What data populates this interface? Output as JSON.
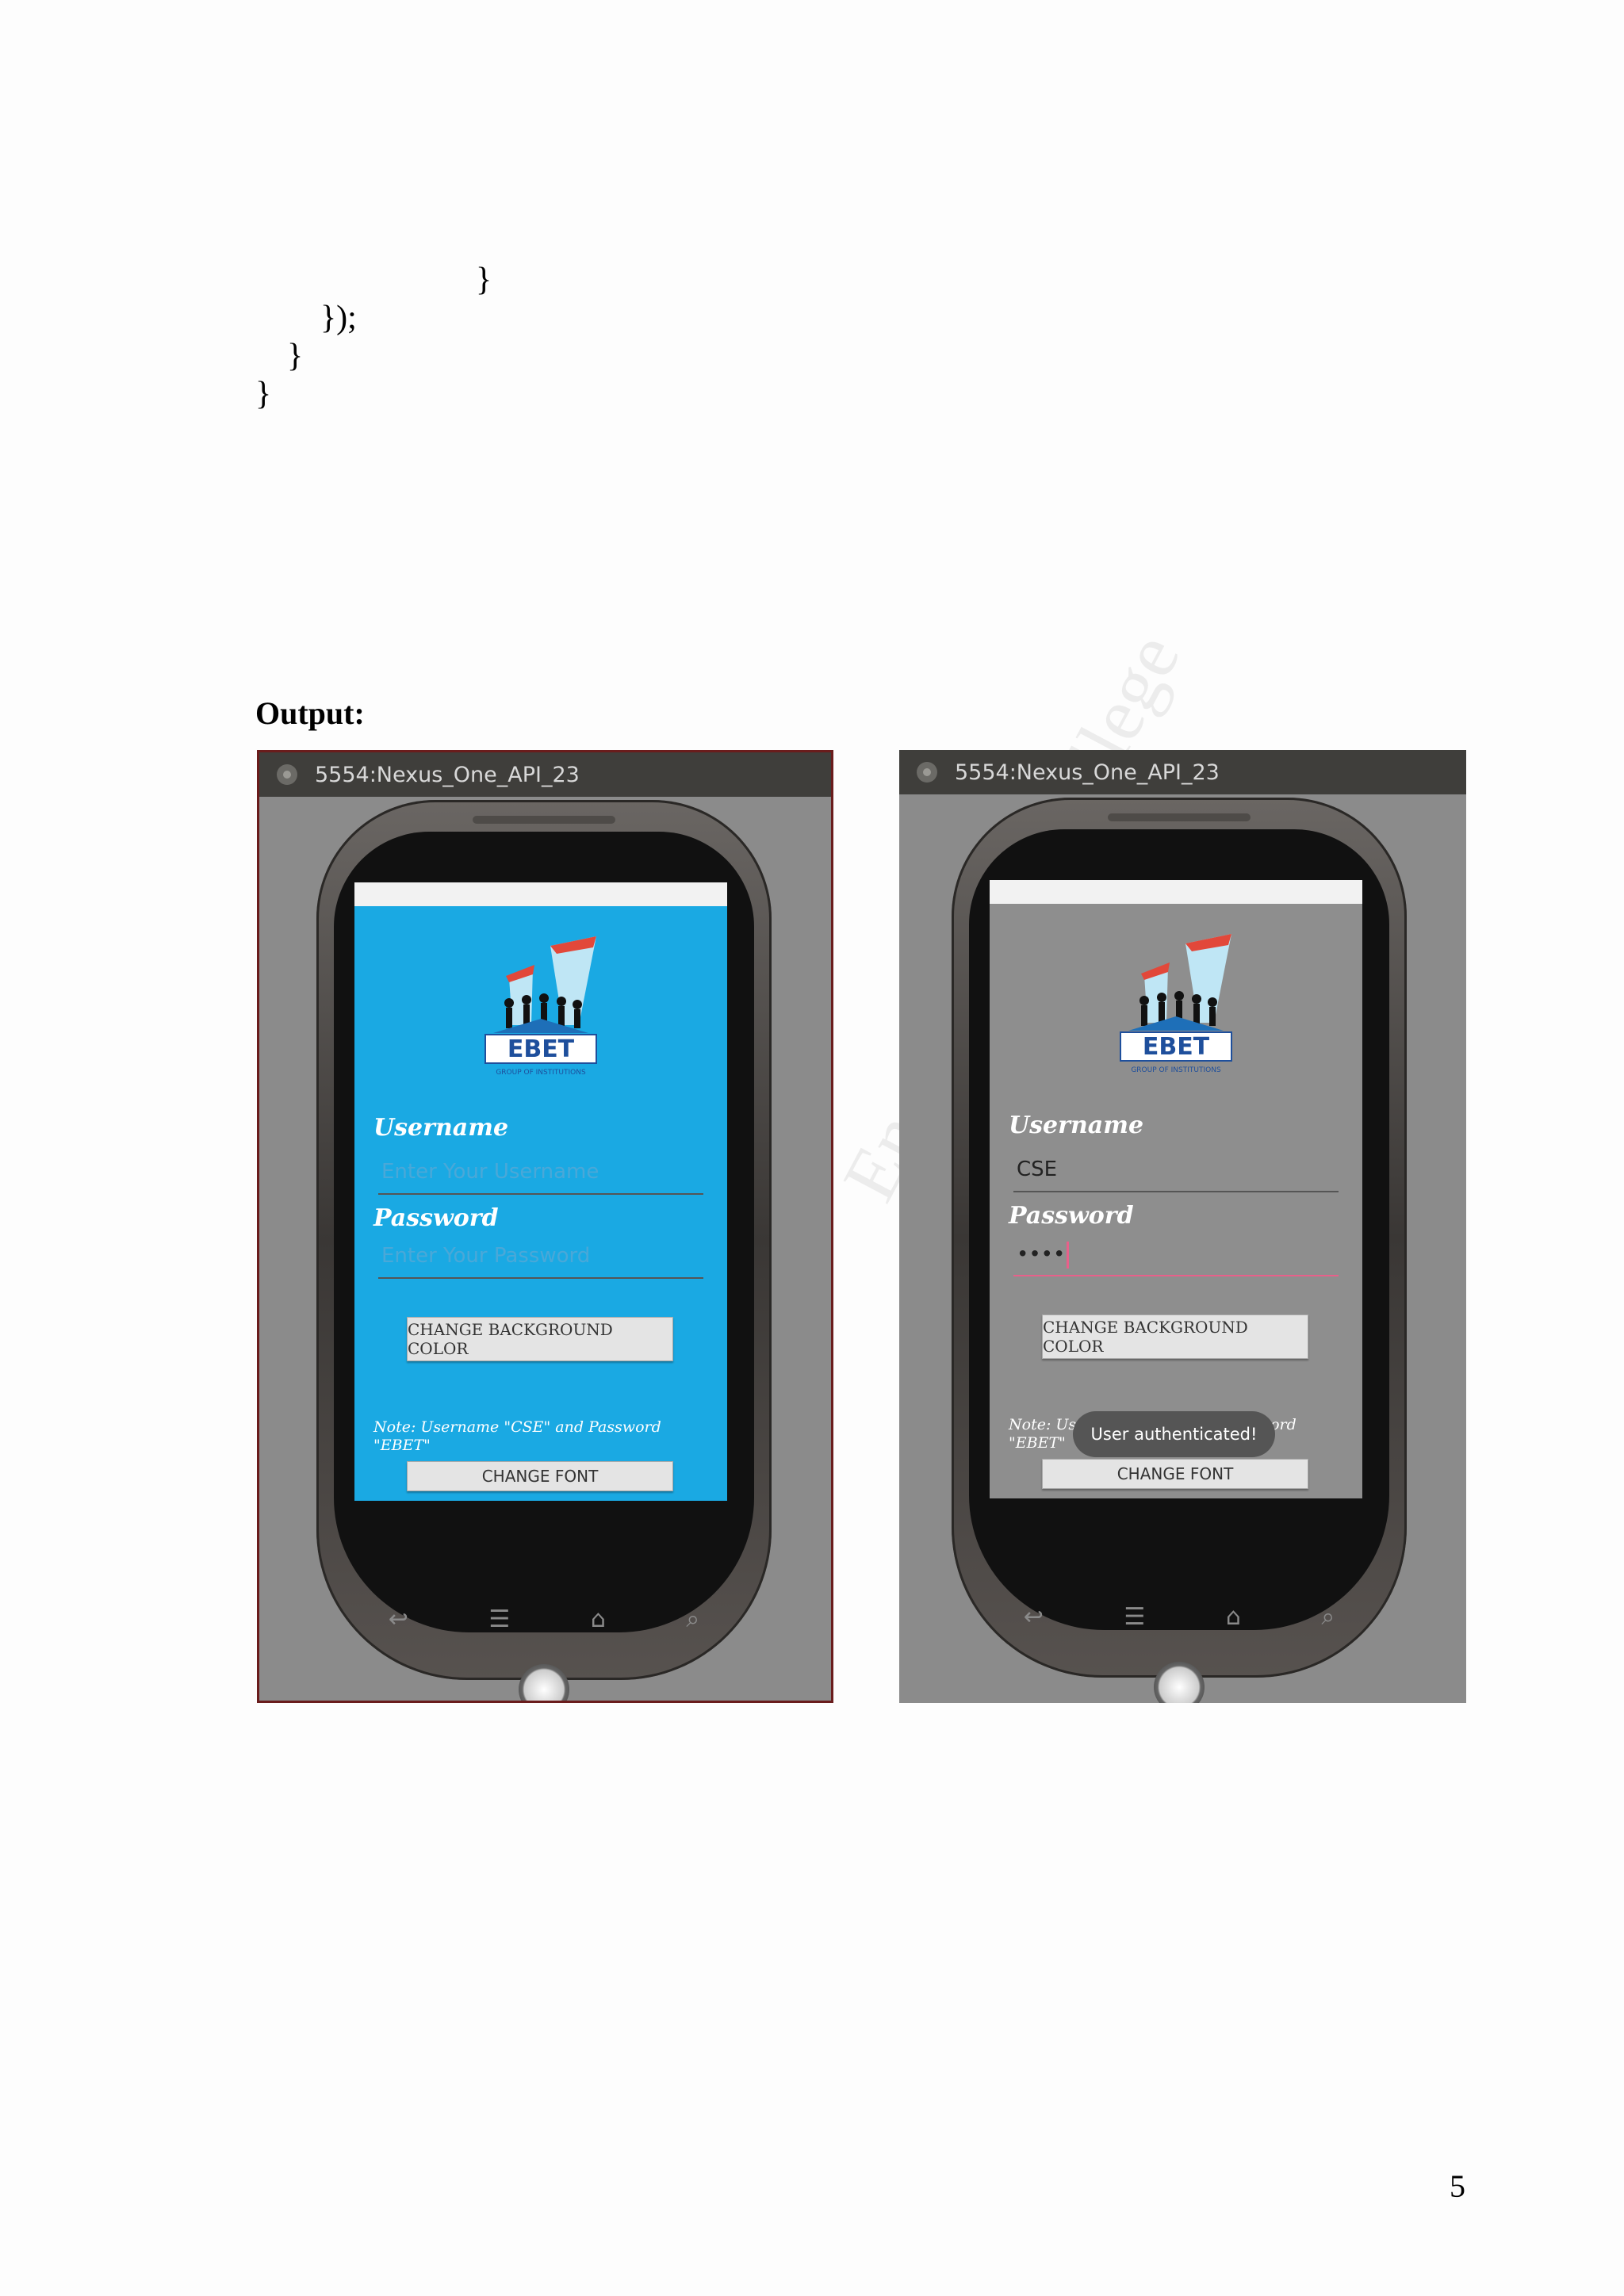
{
  "code": {
    "line1": "}",
    "line2": "});",
    "line3": "}",
    "line4": "}"
  },
  "output_heading": "Output:",
  "page_number": "5",
  "watermark_text": "Engineering College",
  "screenshots": [
    {
      "window_title": "5554:Nexus_One_API_23",
      "background_color": "#1aa9e3",
      "logo_text": "EBET",
      "logo_subtext": "GROUP OF INSTITUTIONS",
      "username_label": "Username",
      "username_placeholder": "Enter Your Username",
      "password_label": "Password",
      "password_placeholder": "Enter Your Password",
      "change_bg_button": "CHANGE BACKGROUND COLOR",
      "note": "Note: Username \"CSE\" and Password \"EBET\"",
      "change_font_button": "CHANGE FONT"
    },
    {
      "window_title": "5554:Nexus_One_API_23",
      "background_color": "#8e8e8e",
      "logo_text": "EBET",
      "logo_subtext": "GROUP OF INSTITUTIONS",
      "username_label": "Username",
      "username_value": "CSE",
      "password_label": "Password",
      "password_value": "••••",
      "change_bg_button": "CHANGE BACKGROUND COLOR",
      "note": "Note: Username \"CSE\" and Password \"EBET\"",
      "toast": "User authenticated!",
      "change_font_button": "CHANGE FONT"
    }
  ],
  "nav_icons": [
    "back-icon",
    "menu-icon",
    "home-icon",
    "search-icon"
  ]
}
